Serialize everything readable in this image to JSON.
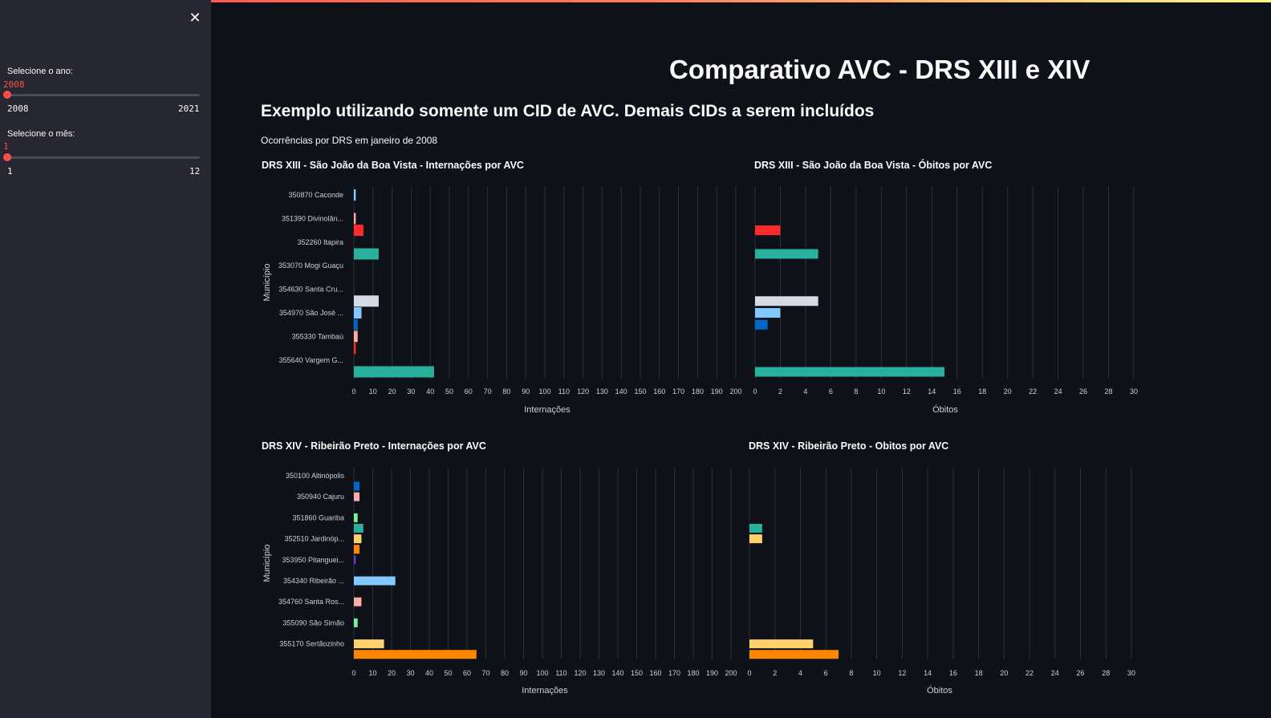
{
  "sidebar": {
    "close_icon": "close-icon",
    "close_glyph": "✕",
    "year_slider": {
      "label": "Selecione o ano:",
      "value": "2008",
      "min": "2008",
      "max": "2021",
      "fraction": 0
    },
    "month_slider": {
      "label": "Selecione o mês:",
      "value": "1",
      "min": "1",
      "max": "12",
      "fraction": 0
    }
  },
  "main": {
    "title": "Comparativo AVC - DRS XIII e XIV",
    "subtitle": "Exemplo utilizando somente um CID de AVC. Demais CIDs a serem incluídos",
    "caption": "Ocorrências por DRS em janeiro de 2008"
  },
  "colors": {
    "accent": "#ff4b4b",
    "background": "#0e1117",
    "sidebar": "#262730",
    "grid": "#2b2f3a"
  },
  "chart_data": [
    {
      "id": "c1",
      "type": "bar",
      "orientation": "horizontal",
      "title": "DRS XIII - São João da Boa Vista - Internações por AVC",
      "xlabel": "Internações",
      "ylabel": "Município",
      "xlim": [
        0,
        200
      ],
      "xticks": [
        0,
        10,
        20,
        30,
        40,
        50,
        60,
        70,
        80,
        90,
        100,
        110,
        120,
        130,
        140,
        150,
        160,
        170,
        180,
        190,
        200
      ],
      "categories": [
        "350870 Caconde",
        "351390 Divinolân...",
        "352260 Itapira",
        "353070 Mogi Guaçu",
        "354630 Santa Cru...",
        "354970 São José ...",
        "355330 Tambaú",
        "355640 Vargem G..."
      ],
      "bars": [
        {
          "slot": 0.0,
          "value": 1,
          "color": "#83c9ff"
        },
        {
          "slot": 1.0,
          "value": 1,
          "color": "#ffabab"
        },
        {
          "slot": 1.5,
          "value": 5,
          "color": "#ff2b2b"
        },
        {
          "slot": 2.5,
          "value": 13,
          "color": "#29b09d"
        },
        {
          "slot": 4.5,
          "value": 13,
          "color": "#d5dae5"
        },
        {
          "slot": 5.0,
          "value": 4,
          "color": "#83c9ff"
        },
        {
          "slot": 5.5,
          "value": 2,
          "color": "#0068c9"
        },
        {
          "slot": 6.0,
          "value": 2,
          "color": "#ffabab"
        },
        {
          "slot": 6.5,
          "value": 1,
          "color": "#ff2b2b"
        },
        {
          "slot": 7.5,
          "value": 42,
          "color": "#29b09d"
        }
      ]
    },
    {
      "id": "c2",
      "type": "bar",
      "orientation": "horizontal",
      "title": "DRS XIII - São João da Boa Vista - Óbitos por AVC",
      "xlabel": "Óbitos",
      "ylabel": "",
      "xlim": [
        0,
        30
      ],
      "xticks": [
        0,
        2,
        4,
        6,
        8,
        10,
        12,
        14,
        16,
        18,
        20,
        22,
        24,
        26,
        28,
        30
      ],
      "categories": [],
      "bars": [
        {
          "slot": 1.5,
          "value": 2,
          "color": "#ff2b2b"
        },
        {
          "slot": 2.5,
          "value": 5,
          "color": "#29b09d"
        },
        {
          "slot": 4.5,
          "value": 5,
          "color": "#d5dae5"
        },
        {
          "slot": 5.0,
          "value": 2,
          "color": "#83c9ff"
        },
        {
          "slot": 5.5,
          "value": 1,
          "color": "#0068c9"
        },
        {
          "slot": 7.5,
          "value": 15,
          "color": "#29b09d"
        }
      ]
    },
    {
      "id": "c3",
      "type": "bar",
      "orientation": "horizontal",
      "title": "DRS XIV - Ribeirão Preto - Internações por AVC",
      "xlabel": "Internações",
      "ylabel": "Município",
      "xlim": [
        0,
        200
      ],
      "xticks": [
        0,
        10,
        20,
        30,
        40,
        50,
        60,
        70,
        80,
        90,
        100,
        110,
        120,
        130,
        140,
        150,
        160,
        170,
        180,
        190,
        200
      ],
      "categories": [
        "350100 Altinópolis",
        "350940 Cajuru",
        "351860 Guariba",
        "352510 Jardinóp...",
        "353950 Pitanguei...",
        "354340 Ribeirão ...",
        "354760 Santa Ros...",
        "355090 São Simão",
        "355170 Sertãozinho"
      ],
      "bars": [
        {
          "slot": 0.5,
          "value": 3,
          "color": "#0068c9"
        },
        {
          "slot": 1.0,
          "value": 3,
          "color": "#ffabab"
        },
        {
          "slot": 2.0,
          "value": 2,
          "color": "#7defa1"
        },
        {
          "slot": 2.5,
          "value": 5,
          "color": "#29b09d"
        },
        {
          "slot": 3.0,
          "value": 4,
          "color": "#ffd16a"
        },
        {
          "slot": 3.5,
          "value": 3,
          "color": "#ff8700"
        },
        {
          "slot": 4.0,
          "value": 1,
          "color": "#6d3fc0"
        },
        {
          "slot": 5.0,
          "value": 22,
          "color": "#83c9ff"
        },
        {
          "slot": 6.0,
          "value": 4,
          "color": "#ffabab"
        },
        {
          "slot": 7.0,
          "value": 2,
          "color": "#7defa1"
        },
        {
          "slot": 8.0,
          "value": 16,
          "color": "#ffd16a"
        },
        {
          "slot": 8.5,
          "value": 65,
          "color": "#ff8700"
        }
      ]
    },
    {
      "id": "c4",
      "type": "bar",
      "orientation": "horizontal",
      "title": "DRS XIV - Ribeirão Preto - Obitos por AVC",
      "xlabel": "Óbitos",
      "ylabel": "",
      "xlim": [
        0,
        30
      ],
      "xticks": [
        0,
        2,
        4,
        6,
        8,
        10,
        12,
        14,
        16,
        18,
        20,
        22,
        24,
        26,
        28,
        30
      ],
      "categories": [],
      "bars": [
        {
          "slot": 2.5,
          "value": 1,
          "color": "#29b09d"
        },
        {
          "slot": 3.0,
          "value": 1,
          "color": "#ffd16a"
        },
        {
          "slot": 8.0,
          "value": 5,
          "color": "#ffd16a"
        },
        {
          "slot": 8.5,
          "value": 7,
          "color": "#ff8700"
        }
      ]
    }
  ]
}
